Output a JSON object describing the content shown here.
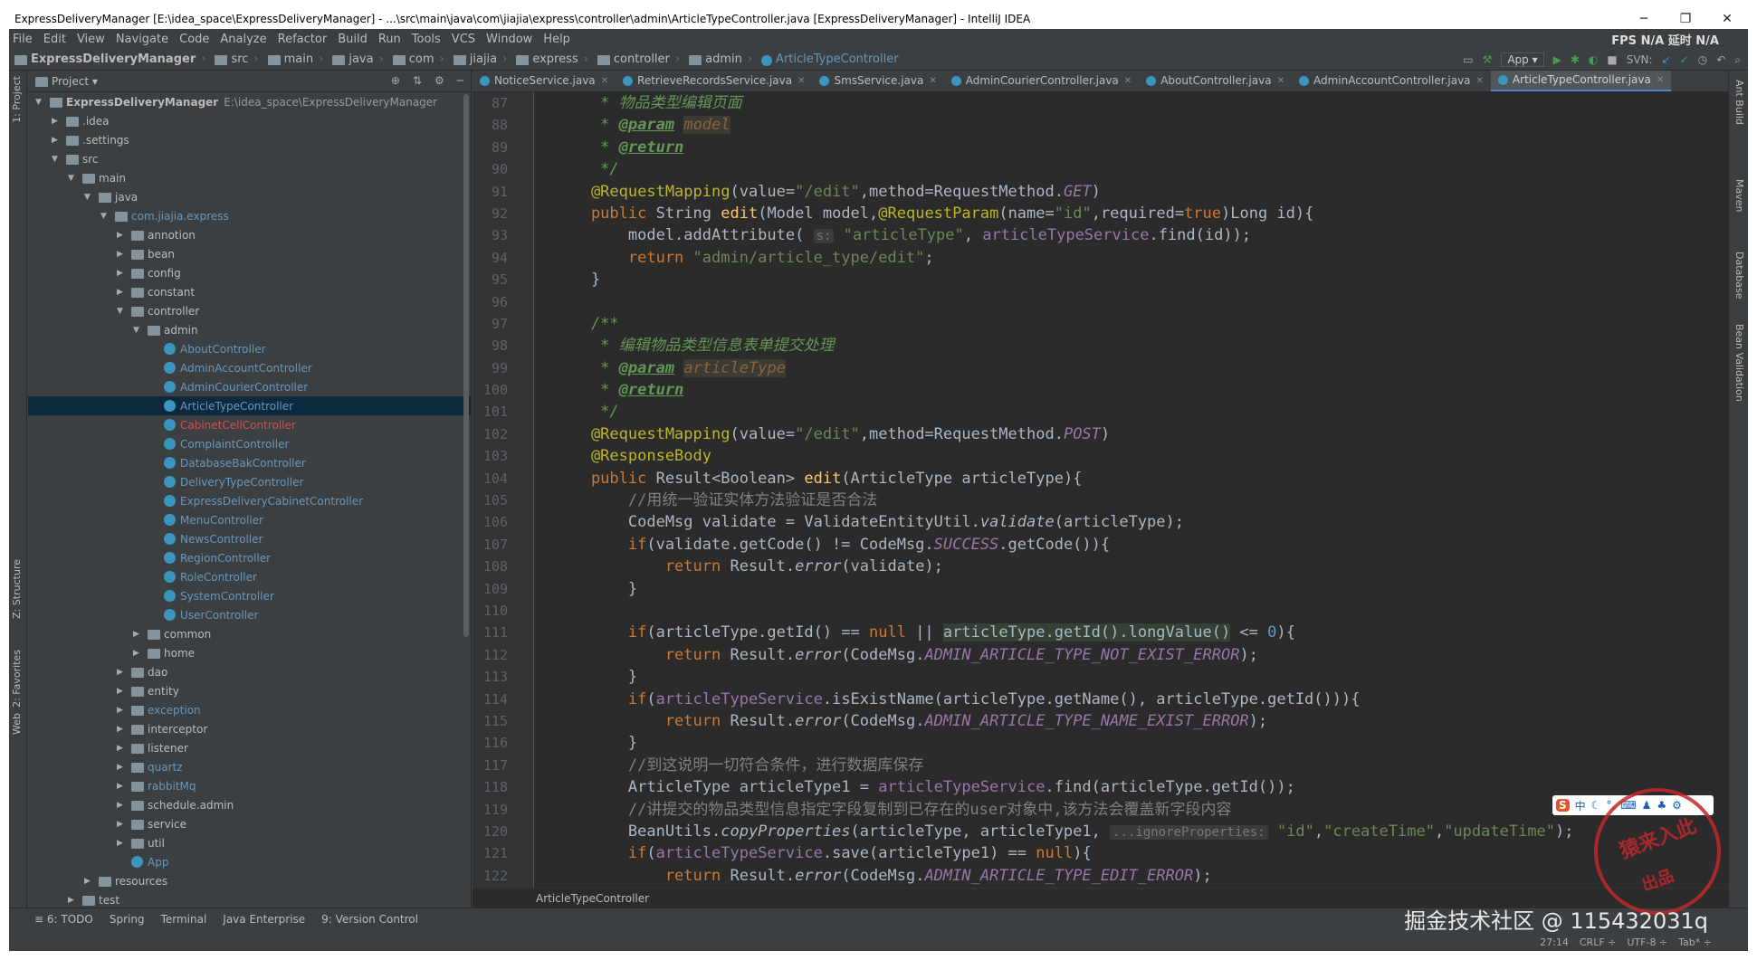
{
  "window": {
    "title": "ExpressDeliveryManager [E:\\idea_space\\ExpressDeliveryManager] - ...\\src\\main\\java\\com\\jiajia\\express\\controller\\admin\\ArticleTypeController.java [ExpressDeliveryManager] - IntelliJ IDEA",
    "controls": [
      "─",
      "❐",
      "✕"
    ]
  },
  "menu": [
    "File",
    "Edit",
    "View",
    "Navigate",
    "Code",
    "Analyze",
    "Refactor",
    "Build",
    "Run",
    "Tools",
    "VCS",
    "Window",
    "Help"
  ],
  "fps": "FPS  N/A  延时  N/A",
  "breadcrumbs": [
    "ExpressDeliveryManager",
    "src",
    "main",
    "java",
    "com",
    "jiajia",
    "express",
    "controller",
    "admin",
    "ArticleTypeController"
  ],
  "toolbar": {
    "run_config": "App ▾",
    "svn": "SVN:"
  },
  "left_stripe": [
    "1: Project",
    "Z: Structure",
    "2: Favorites",
    "Web"
  ],
  "right_stripe": [
    "Ant Build",
    "Maven",
    "Database",
    "Bean Validation"
  ],
  "project": {
    "header": "Project ▾",
    "tree": [
      {
        "label": "ExpressDeliveryManager",
        "extra": "E:\\idea_space\\ExpressDeliveryManager",
        "depth": 0,
        "arrow": "▼",
        "type": "folder"
      },
      {
        "label": ".idea",
        "depth": 1,
        "arrow": "▶",
        "type": "folder"
      },
      {
        "label": ".settings",
        "depth": 1,
        "arrow": "▶",
        "type": "folder"
      },
      {
        "label": "src",
        "depth": 1,
        "arrow": "▼",
        "type": "folder"
      },
      {
        "label": "main",
        "depth": 2,
        "arrow": "▼",
        "type": "folder"
      },
      {
        "label": "java",
        "depth": 3,
        "arrow": "▼",
        "type": "folder"
      },
      {
        "label": "com.jiajia.express",
        "depth": 4,
        "arrow": "▼",
        "type": "folder",
        "color": "#6897bb"
      },
      {
        "label": "annotion",
        "depth": 5,
        "arrow": "▶",
        "type": "folder"
      },
      {
        "label": "bean",
        "depth": 5,
        "arrow": "▶",
        "type": "folder"
      },
      {
        "label": "config",
        "depth": 5,
        "arrow": "▶",
        "type": "folder"
      },
      {
        "label": "constant",
        "depth": 5,
        "arrow": "▶",
        "type": "folder"
      },
      {
        "label": "controller",
        "depth": 5,
        "arrow": "▼",
        "type": "folder"
      },
      {
        "label": "admin",
        "depth": 6,
        "arrow": "▼",
        "type": "folder"
      },
      {
        "label": "AboutController",
        "depth": 7,
        "type": "class",
        "color": "#6897bb"
      },
      {
        "label": "AdminAccountController",
        "depth": 7,
        "type": "class",
        "color": "#6897bb"
      },
      {
        "label": "AdminCourierController",
        "depth": 7,
        "type": "class",
        "color": "#6897bb"
      },
      {
        "label": "ArticleTypeController",
        "depth": 7,
        "type": "class",
        "color": "#6897bb",
        "selected": true
      },
      {
        "label": "CabinetCellController",
        "depth": 7,
        "type": "class",
        "color": "#d25252"
      },
      {
        "label": "ComplaintController",
        "depth": 7,
        "type": "class",
        "color": "#6897bb"
      },
      {
        "label": "DatabaseBakController",
        "depth": 7,
        "type": "class",
        "color": "#6897bb"
      },
      {
        "label": "DeliveryTypeController",
        "depth": 7,
        "type": "class",
        "color": "#6897bb"
      },
      {
        "label": "ExpressDeliveryCabinetController",
        "depth": 7,
        "type": "class",
        "color": "#6897bb"
      },
      {
        "label": "MenuController",
        "depth": 7,
        "type": "class",
        "color": "#6897bb"
      },
      {
        "label": "NewsController",
        "depth": 7,
        "type": "class",
        "color": "#6897bb"
      },
      {
        "label": "RegionController",
        "depth": 7,
        "type": "class",
        "color": "#6897bb"
      },
      {
        "label": "RoleController",
        "depth": 7,
        "type": "class",
        "color": "#6897bb"
      },
      {
        "label": "SystemController",
        "depth": 7,
        "type": "class",
        "color": "#6897bb"
      },
      {
        "label": "UserController",
        "depth": 7,
        "type": "class",
        "color": "#6897bb"
      },
      {
        "label": "common",
        "depth": 6,
        "arrow": "▶",
        "type": "folder"
      },
      {
        "label": "home",
        "depth": 6,
        "arrow": "▶",
        "type": "folder"
      },
      {
        "label": "dao",
        "depth": 5,
        "arrow": "▶",
        "type": "folder"
      },
      {
        "label": "entity",
        "depth": 5,
        "arrow": "▶",
        "type": "folder"
      },
      {
        "label": "exception",
        "depth": 5,
        "arrow": "▶",
        "type": "folder",
        "color": "#6897bb"
      },
      {
        "label": "interceptor",
        "depth": 5,
        "arrow": "▶",
        "type": "folder"
      },
      {
        "label": "listener",
        "depth": 5,
        "arrow": "▶",
        "type": "folder"
      },
      {
        "label": "quartz",
        "depth": 5,
        "arrow": "▶",
        "type": "folder",
        "color": "#6897bb"
      },
      {
        "label": "rabbitMq",
        "depth": 5,
        "arrow": "▶",
        "type": "folder",
        "color": "#6897bb"
      },
      {
        "label": "schedule.admin",
        "depth": 5,
        "arrow": "▶",
        "type": "folder"
      },
      {
        "label": "service",
        "depth": 5,
        "arrow": "▶",
        "type": "folder"
      },
      {
        "label": "util",
        "depth": 5,
        "arrow": "▶",
        "type": "folder"
      },
      {
        "label": "App",
        "depth": 5,
        "type": "class",
        "color": "#6897bb"
      },
      {
        "label": "resources",
        "depth": 3,
        "arrow": "▶",
        "type": "folder"
      },
      {
        "label": "test",
        "depth": 2,
        "arrow": "▶",
        "type": "folder"
      }
    ]
  },
  "tabs": [
    {
      "label": "NoticeService.java",
      "active": false
    },
    {
      "label": "RetrieveRecordsService.java",
      "active": false
    },
    {
      "label": "SmsService.java",
      "active": false
    },
    {
      "label": "AdminCourierController.java",
      "active": false
    },
    {
      "label": "AboutController.java",
      "active": false
    },
    {
      "label": "AdminAccountController.java",
      "active": false
    },
    {
      "label": "ArticleTypeController.java",
      "active": true
    }
  ],
  "code": {
    "line_numbers": [
      "87",
      "88",
      "89",
      "90",
      "91",
      "92",
      "93",
      "94",
      "95",
      "96",
      "97",
      "98",
      "99",
      "100",
      "101",
      "102",
      "103",
      "104",
      "105",
      "106",
      "107",
      "108",
      "109",
      "110",
      "111",
      "112",
      "113",
      "114",
      "115",
      "116",
      "117",
      "118",
      "119",
      "120",
      "121",
      "122"
    ],
    "lines": [
      [
        [
          "cm",
          "     * 物品类型编辑页面"
        ]
      ],
      [
        [
          "cm",
          "     * "
        ],
        [
          "tag",
          "@param"
        ],
        [
          "cm",
          " "
        ],
        [
          "pn",
          "model"
        ]
      ],
      [
        [
          "cm",
          "     * "
        ],
        [
          "tag",
          "@return"
        ]
      ],
      [
        [
          "cm",
          "     */"
        ]
      ],
      [
        [
          "an",
          "    @RequestMapping"
        ],
        [
          "",
          "(value="
        ],
        [
          "str",
          "\"/edit\""
        ],
        [
          "",
          ",method=RequestMethod."
        ],
        [
          "sf",
          "GET"
        ],
        [
          "",
          ")"
        ]
      ],
      [
        [
          "kw",
          "    public "
        ],
        [
          "",
          "String "
        ],
        [
          "fn",
          "edit"
        ],
        [
          "",
          "(Model model,"
        ],
        [
          "an",
          "@RequestParam"
        ],
        [
          "",
          "(name="
        ],
        [
          "str",
          "\"id\""
        ],
        [
          "",
          ",required="
        ],
        [
          "kw",
          "true"
        ],
        [
          "",
          ")Long id){"
        ]
      ],
      [
        [
          "",
          "        model.addAttribute( "
        ],
        [
          "hint",
          "s:"
        ],
        [
          "str",
          " \"articleType\""
        ],
        [
          "",
          ", "
        ],
        [
          "fld",
          "articleTypeService"
        ],
        [
          "",
          ".find(id));"
        ]
      ],
      [
        [
          "kw",
          "        return "
        ],
        [
          "str",
          "\"admin/article_type/edit\""
        ],
        [
          "",
          ";"
        ]
      ],
      [
        [
          "",
          "    }"
        ]
      ],
      [
        [
          "",
          ""
        ]
      ],
      [
        [
          "cm",
          "    /**"
        ]
      ],
      [
        [
          "cm",
          "     * 编辑物品类型信息表单提交处理"
        ]
      ],
      [
        [
          "cm",
          "     * "
        ],
        [
          "tag",
          "@param"
        ],
        [
          "cm",
          " "
        ],
        [
          "pn",
          "articleType"
        ]
      ],
      [
        [
          "cm",
          "     * "
        ],
        [
          "tag",
          "@return"
        ]
      ],
      [
        [
          "cm",
          "     */"
        ]
      ],
      [
        [
          "an",
          "    @RequestMapping"
        ],
        [
          "",
          "(value="
        ],
        [
          "str",
          "\"/edit\""
        ],
        [
          "",
          ",method=RequestMethod."
        ],
        [
          "sf",
          "POST"
        ],
        [
          "",
          ")"
        ]
      ],
      [
        [
          "an",
          "    @ResponseBody"
        ]
      ],
      [
        [
          "kw",
          "    public "
        ],
        [
          "",
          "Result<Boolean> "
        ],
        [
          "fn",
          "edit"
        ],
        [
          "",
          "(ArticleType articleType){"
        ]
      ],
      [
        [
          "lc",
          "        //用统一验证实体方法验证是否合法"
        ]
      ],
      [
        [
          "",
          "        CodeMsg validate = ValidateEntityUtil."
        ],
        [
          "it",
          "validate"
        ],
        [
          "",
          "(articleType);"
        ]
      ],
      [
        [
          "kw",
          "        if"
        ],
        [
          "",
          "(validate.getCode() != CodeMsg."
        ],
        [
          "sf",
          "SUCCESS"
        ],
        [
          "",
          ".getCode()){"
        ]
      ],
      [
        [
          "kw",
          "            return "
        ],
        [
          "",
          "Result."
        ],
        [
          "it",
          "error"
        ],
        [
          "",
          "(validate);"
        ]
      ],
      [
        [
          "",
          "        }"
        ]
      ],
      [
        [
          "",
          ""
        ]
      ],
      [
        [
          "kw",
          "        if"
        ],
        [
          "",
          "(articleType.getId() == "
        ],
        [
          "kw",
          "null"
        ],
        [
          "",
          " || "
        ],
        [
          "hl",
          "articleType.getId().longValue()"
        ],
        [
          "",
          " <= "
        ],
        [
          "num",
          "0"
        ],
        [
          "",
          "){"
        ]
      ],
      [
        [
          "kw",
          "            return "
        ],
        [
          "",
          "Result."
        ],
        [
          "it",
          "error"
        ],
        [
          "",
          "(CodeMsg."
        ],
        [
          "sf",
          "ADMIN_ARTICLE_TYPE_NOT_EXIST_ERROR"
        ],
        [
          "",
          ");"
        ]
      ],
      [
        [
          "",
          "        }"
        ]
      ],
      [
        [
          "kw",
          "        if"
        ],
        [
          "",
          "("
        ],
        [
          "fld",
          "articleTypeService"
        ],
        [
          "",
          ".isExistName(articleType.getName(), articleType.getId())){"
        ]
      ],
      [
        [
          "kw",
          "            return "
        ],
        [
          "",
          "Result."
        ],
        [
          "it",
          "error"
        ],
        [
          "",
          "(CodeMsg."
        ],
        [
          "sf",
          "ADMIN_ARTICLE_TYPE_NAME_EXIST_ERROR"
        ],
        [
          "",
          ");"
        ]
      ],
      [
        [
          "",
          "        }"
        ]
      ],
      [
        [
          "lc",
          "        //到这说明一切符合条件，进行数据库保存"
        ]
      ],
      [
        [
          "",
          "        ArticleType articleType1 = "
        ],
        [
          "fld",
          "articleTypeService"
        ],
        [
          "",
          ".find(articleType.getId());"
        ]
      ],
      [
        [
          "lc",
          "        //讲提交的物品类型信息指定字段复制到已存在的user对象中,该方法会覆盖新字段内容"
        ]
      ],
      [
        [
          "",
          "        BeanUtils."
        ],
        [
          "it",
          "copyProperties"
        ],
        [
          "",
          "(articleType, articleType1, "
        ],
        [
          "hint",
          "...ignoreProperties:"
        ],
        [
          "str",
          " \"id\""
        ],
        [
          "",
          ","
        ],
        [
          "str",
          "\"createTime\""
        ],
        [
          "",
          ","
        ],
        [
          "str",
          "\"updateTime\""
        ],
        [
          "",
          ");"
        ]
      ],
      [
        [
          "kw",
          "        if"
        ],
        [
          "",
          "("
        ],
        [
          "fld",
          "articleTypeService"
        ],
        [
          "",
          ".save(articleType1) == "
        ],
        [
          "kw",
          "null"
        ],
        [
          "",
          "){"
        ]
      ],
      [
        [
          "kw",
          "            return "
        ],
        [
          "",
          "Result."
        ],
        [
          "it",
          "error"
        ],
        [
          "",
          "(CodeMsg."
        ],
        [
          "sf",
          "ADMIN_ARTICLE_TYPE_EDIT_ERROR"
        ],
        [
          "",
          ");"
        ]
      ]
    ]
  },
  "editor_breadcrumb": "ArticleTypeController",
  "bottom_tools": [
    "≡ 6: TODO",
    "Spring",
    "Terminal",
    "Java Enterprise",
    "9: Version Control"
  ],
  "status": {
    "position": "27:14",
    "line_sep": "CRLF ÷",
    "encoding": "UTF-8 ÷",
    "indent": "Tab* ÷"
  },
  "watermark": "掘金技术社区 @ 115432031q",
  "stamp": {
    "line1": "猿来入此",
    "line2": "出品"
  },
  "ime": {
    "logo": "S",
    "lang": "中"
  }
}
